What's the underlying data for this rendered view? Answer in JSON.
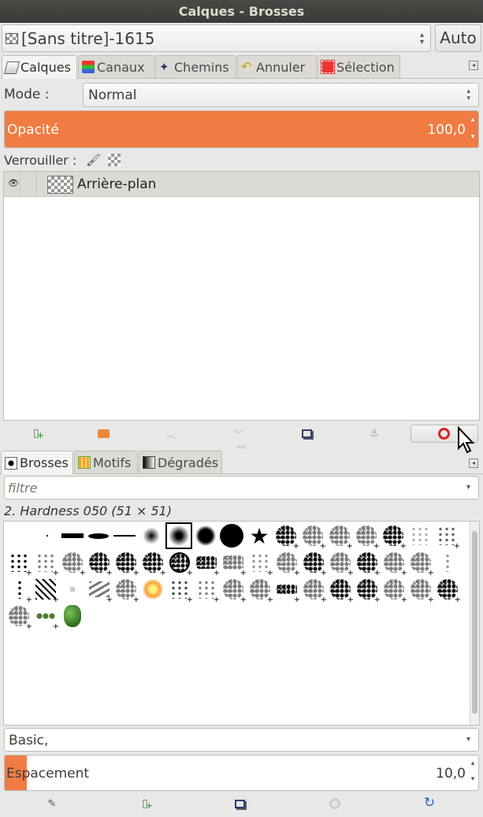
{
  "window": {
    "title": "Calques - Brosses"
  },
  "image_selector": {
    "value": "[Sans titre]-1615",
    "auto_label": "Auto"
  },
  "top_tabs": [
    {
      "label": "Calques",
      "icon": "layers-icon"
    },
    {
      "label": "Canaux",
      "icon": "channels-icon"
    },
    {
      "label": "Chemins",
      "icon": "paths-icon"
    },
    {
      "label": "Annuler",
      "icon": "undo-history-icon"
    },
    {
      "label": "Sélection",
      "icon": "selection-editor-icon"
    }
  ],
  "layers": {
    "mode_label": "Mode :",
    "mode_value": "Normal",
    "opacity_label": "Opacité",
    "opacity_value": "100,0",
    "opacity_fraction": 1.0,
    "lock_label": "Verrouiller :",
    "items": [
      {
        "name": "Arrière-plan",
        "visible": true
      }
    ]
  },
  "layers_toolbar": [
    "new-layer-icon",
    "new-layer-group-icon",
    "raise-layer-icon",
    "lower-layer-icon",
    "duplicate-layer-icon",
    "anchor-layer-icon",
    "delete-layer-icon"
  ],
  "bottom_tabs": [
    {
      "label": "Brosses",
      "icon": "brushes-icon"
    },
    {
      "label": "Motifs",
      "icon": "patterns-icon"
    },
    {
      "label": "Dégradés",
      "icon": "gradients-icon"
    }
  ],
  "brushes": {
    "filter_placeholder": "filtre",
    "selected_name": "2. Hardness 050 (51 × 51)",
    "tag_value": "Basic,",
    "spacing_label": "Espacement",
    "spacing_value": "10,0",
    "spacing_fraction": 0.1
  },
  "brushes_toolbar": [
    "edit-brush-icon",
    "new-brush-icon",
    "duplicate-brush-icon",
    "delete-brush-icon",
    "refresh-brushes-icon"
  ],
  "colors": {
    "accent": "#f07c43",
    "border": "#c0bdb7",
    "bg": "#e8e8e7"
  }
}
